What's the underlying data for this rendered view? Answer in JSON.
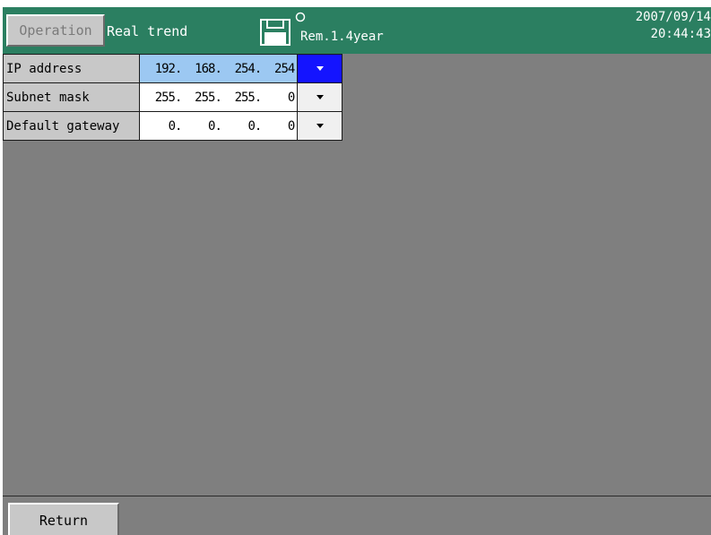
{
  "header": {
    "operation_button": "Operation",
    "mode_title": "Real trend",
    "memory_remaining": "Rem.1.4year",
    "date": "2007/09/14",
    "time": "20:44:43",
    "colors": {
      "header_bg": "#2b7f61",
      "selected_value_bg": "#9cc8f2",
      "selected_drop_bg": "#1414ff"
    }
  },
  "settings": {
    "rows": [
      {
        "label": "IP address",
        "octets": [
          "192",
          "168",
          "254",
          "254"
        ],
        "selected": true
      },
      {
        "label": "Subnet mask",
        "octets": [
          "255",
          "255",
          "255",
          "0"
        ],
        "selected": false
      },
      {
        "label": "Default gateway",
        "octets": [
          "0",
          "0",
          "0",
          "0"
        ],
        "selected": false
      }
    ],
    "octet_separator": "."
  },
  "footer": {
    "return_button": "Return"
  }
}
